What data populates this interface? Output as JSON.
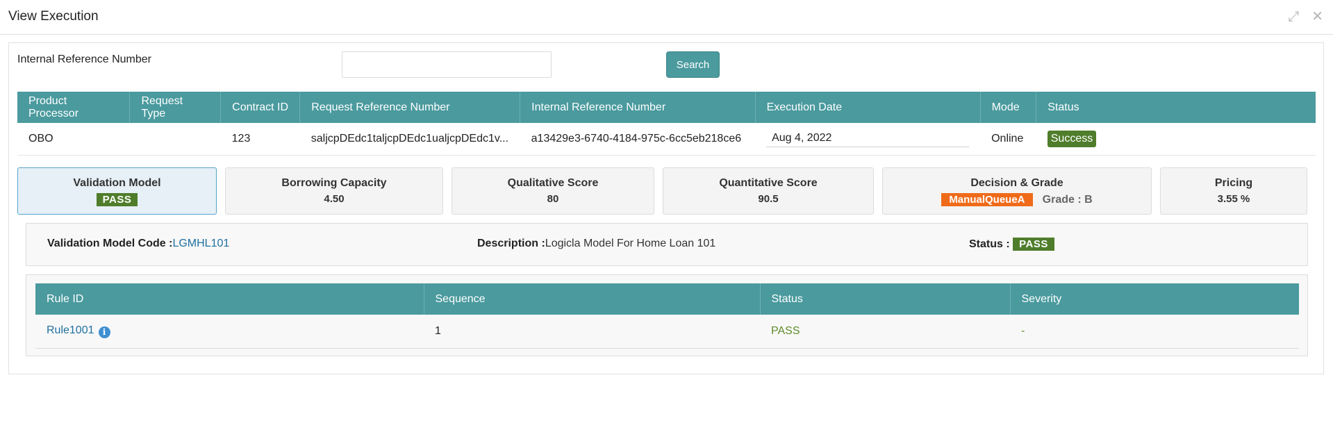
{
  "window": {
    "title": "View Execution",
    "icons": [
      "collapse-icon",
      "close-icon"
    ]
  },
  "search": {
    "label": "Internal Reference Number",
    "value": "",
    "placeholder": "",
    "button_label": "Search"
  },
  "execution_table": {
    "headers": [
      "Product Processor",
      "Request Type",
      "Contract ID",
      "Request Reference Number",
      "Internal Reference Number",
      "Execution Date",
      "Mode",
      "Status"
    ],
    "row": {
      "product_processor": "OBO",
      "request_type": "",
      "contract_id": "123",
      "request_reference_number": "saljcpDEdc1taljcpDEdc1ualjcpDEdc1v...",
      "internal_reference_number": "a13429e3-6740-4184-975c-6cc5eb218ce6",
      "execution_date": "Aug 4, 2022",
      "mode": "Online",
      "status": "Success"
    }
  },
  "summary_cards": {
    "validation_model": {
      "title": "Validation Model",
      "value": "PASS"
    },
    "borrowing_capacity": {
      "title": "Borrowing Capacity",
      "value": "4.50"
    },
    "qualitative_score": {
      "title": "Qualitative Score",
      "value": "80"
    },
    "quantitative_score": {
      "title": "Quantitative Score",
      "value": "90.5"
    },
    "decision_grade": {
      "title": "Decision & Grade",
      "decision": "ManualQueueA",
      "grade": "Grade : B"
    },
    "pricing": {
      "title": "Pricing",
      "value": "3.55 %"
    }
  },
  "validation_detail": {
    "code_label": "Validation Model Code :",
    "code_value": "LGMHL101",
    "description_label": "Description :",
    "description_value": "Logicla Model For Home Loan 101",
    "status_label": "Status :",
    "status_value": "PASS"
  },
  "rules_table": {
    "headers": [
      "Rule ID",
      "Sequence",
      "Status",
      "Severity"
    ],
    "row": {
      "rule_id": "Rule1001",
      "info_icon": "info-icon",
      "sequence": "1",
      "status": "PASS",
      "severity": "-"
    }
  },
  "colors": {
    "header_teal": "#4a9a9e",
    "pass_green": "#4f7d2b",
    "queue_orange": "#ef6b1a",
    "link_blue": "#1f6fa0",
    "active_card_bg": "#e6f0f6"
  }
}
